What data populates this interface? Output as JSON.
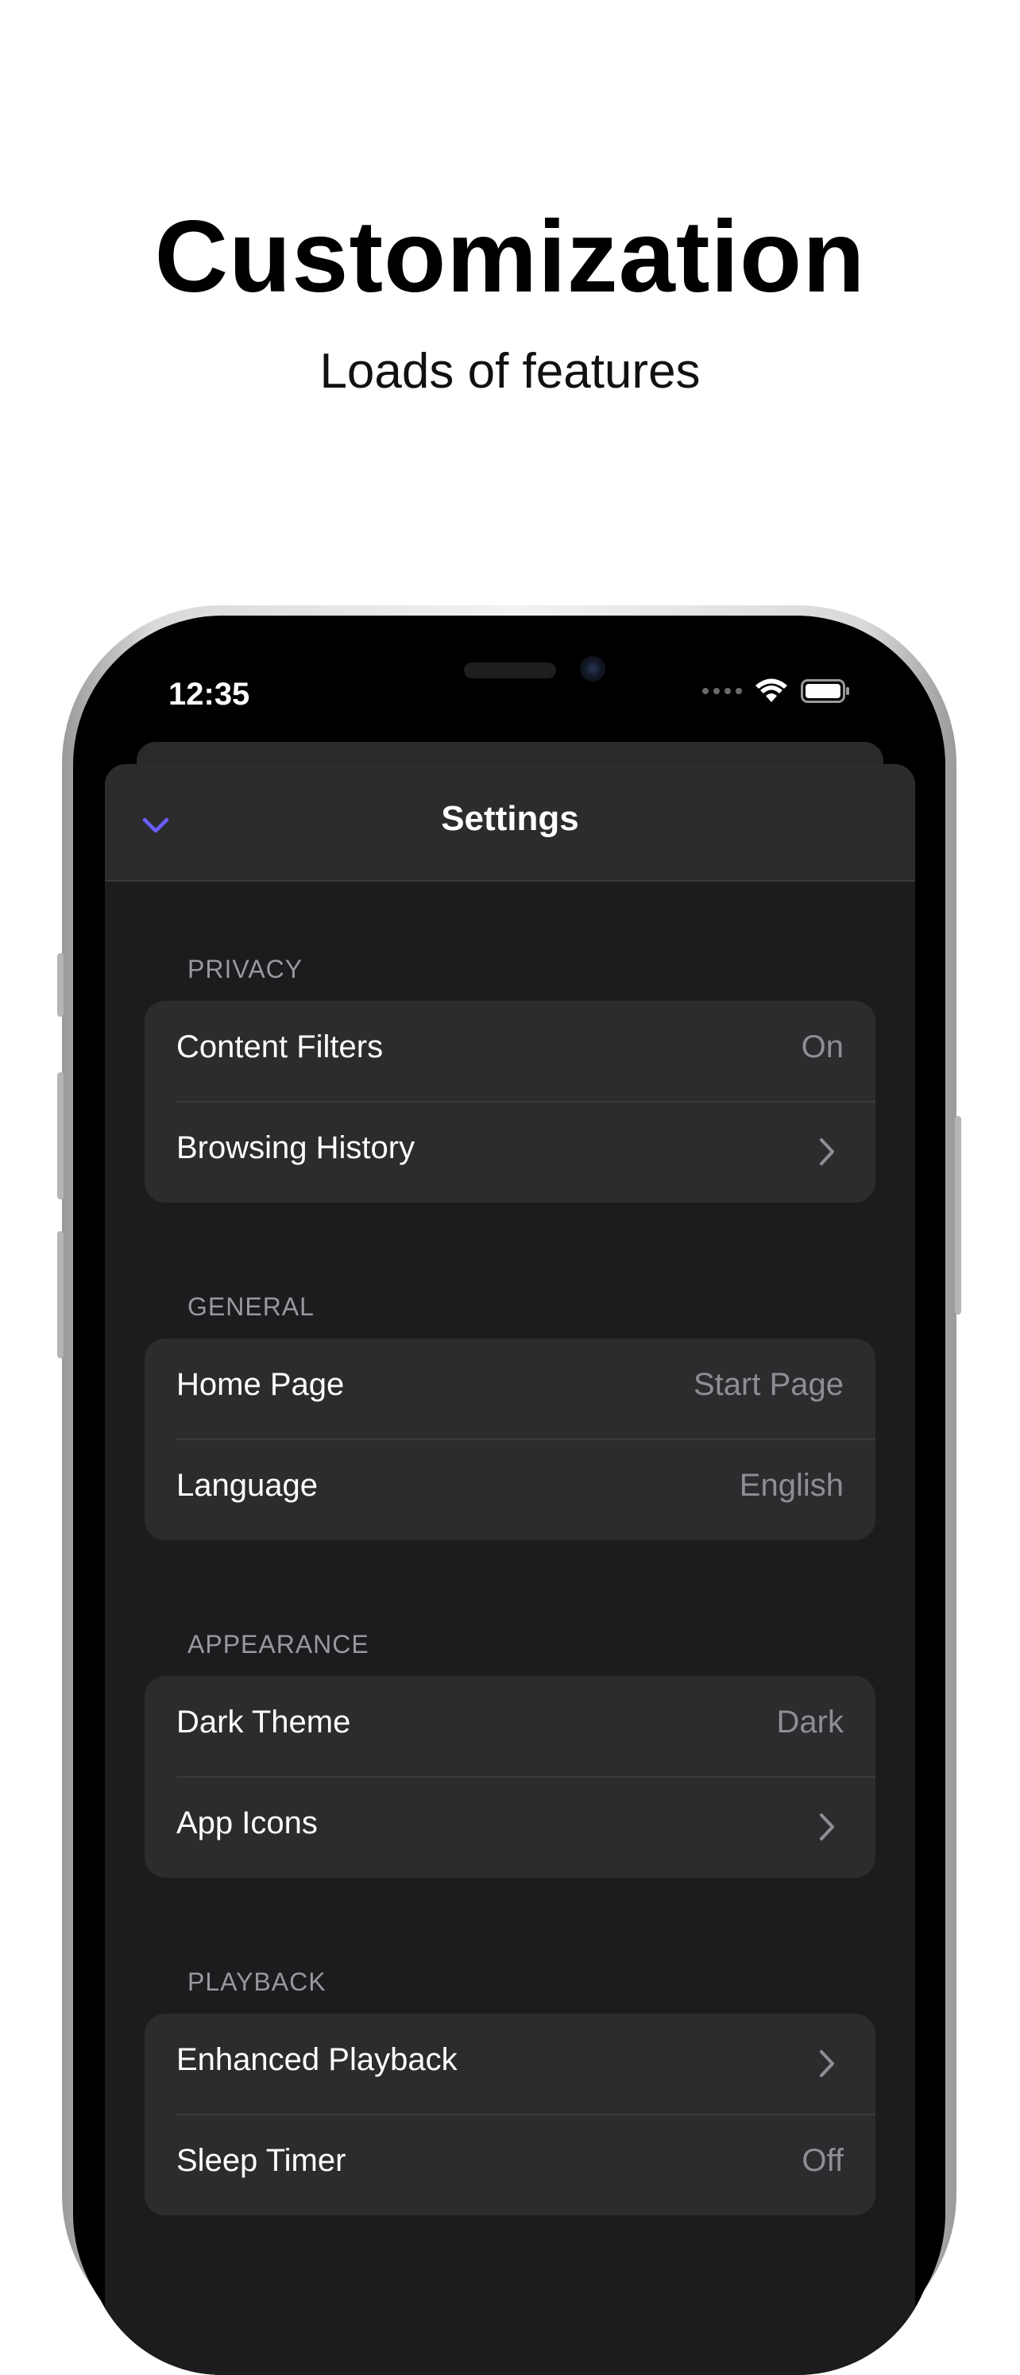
{
  "hero": {
    "title": "Customization",
    "subtitle": "Loads of features"
  },
  "status_bar": {
    "time": "12:35",
    "icons": [
      "cellular-icon",
      "wifi-icon",
      "battery-icon"
    ]
  },
  "settings": {
    "nav_title": "Settings",
    "accent_color": "#6b5cff",
    "sections": [
      {
        "header": "PRIVACY",
        "rows": [
          {
            "label": "Content Filters",
            "value": "On"
          },
          {
            "label": "Browsing History",
            "accessory": "chevron-right-icon"
          }
        ]
      },
      {
        "header": "GENERAL",
        "rows": [
          {
            "label": "Home Page",
            "value": "Start Page"
          },
          {
            "label": "Language",
            "value": "English"
          }
        ]
      },
      {
        "header": "APPEARANCE",
        "rows": [
          {
            "label": "Dark Theme",
            "value": "Dark"
          },
          {
            "label": "App Icons",
            "accessory": "chevron-right-icon"
          }
        ]
      },
      {
        "header": "PLAYBACK",
        "rows": [
          {
            "label": "Enhanced Playback",
            "accessory": "chevron-right-icon"
          },
          {
            "label": "Sleep Timer",
            "value": "Off"
          }
        ]
      }
    ]
  }
}
